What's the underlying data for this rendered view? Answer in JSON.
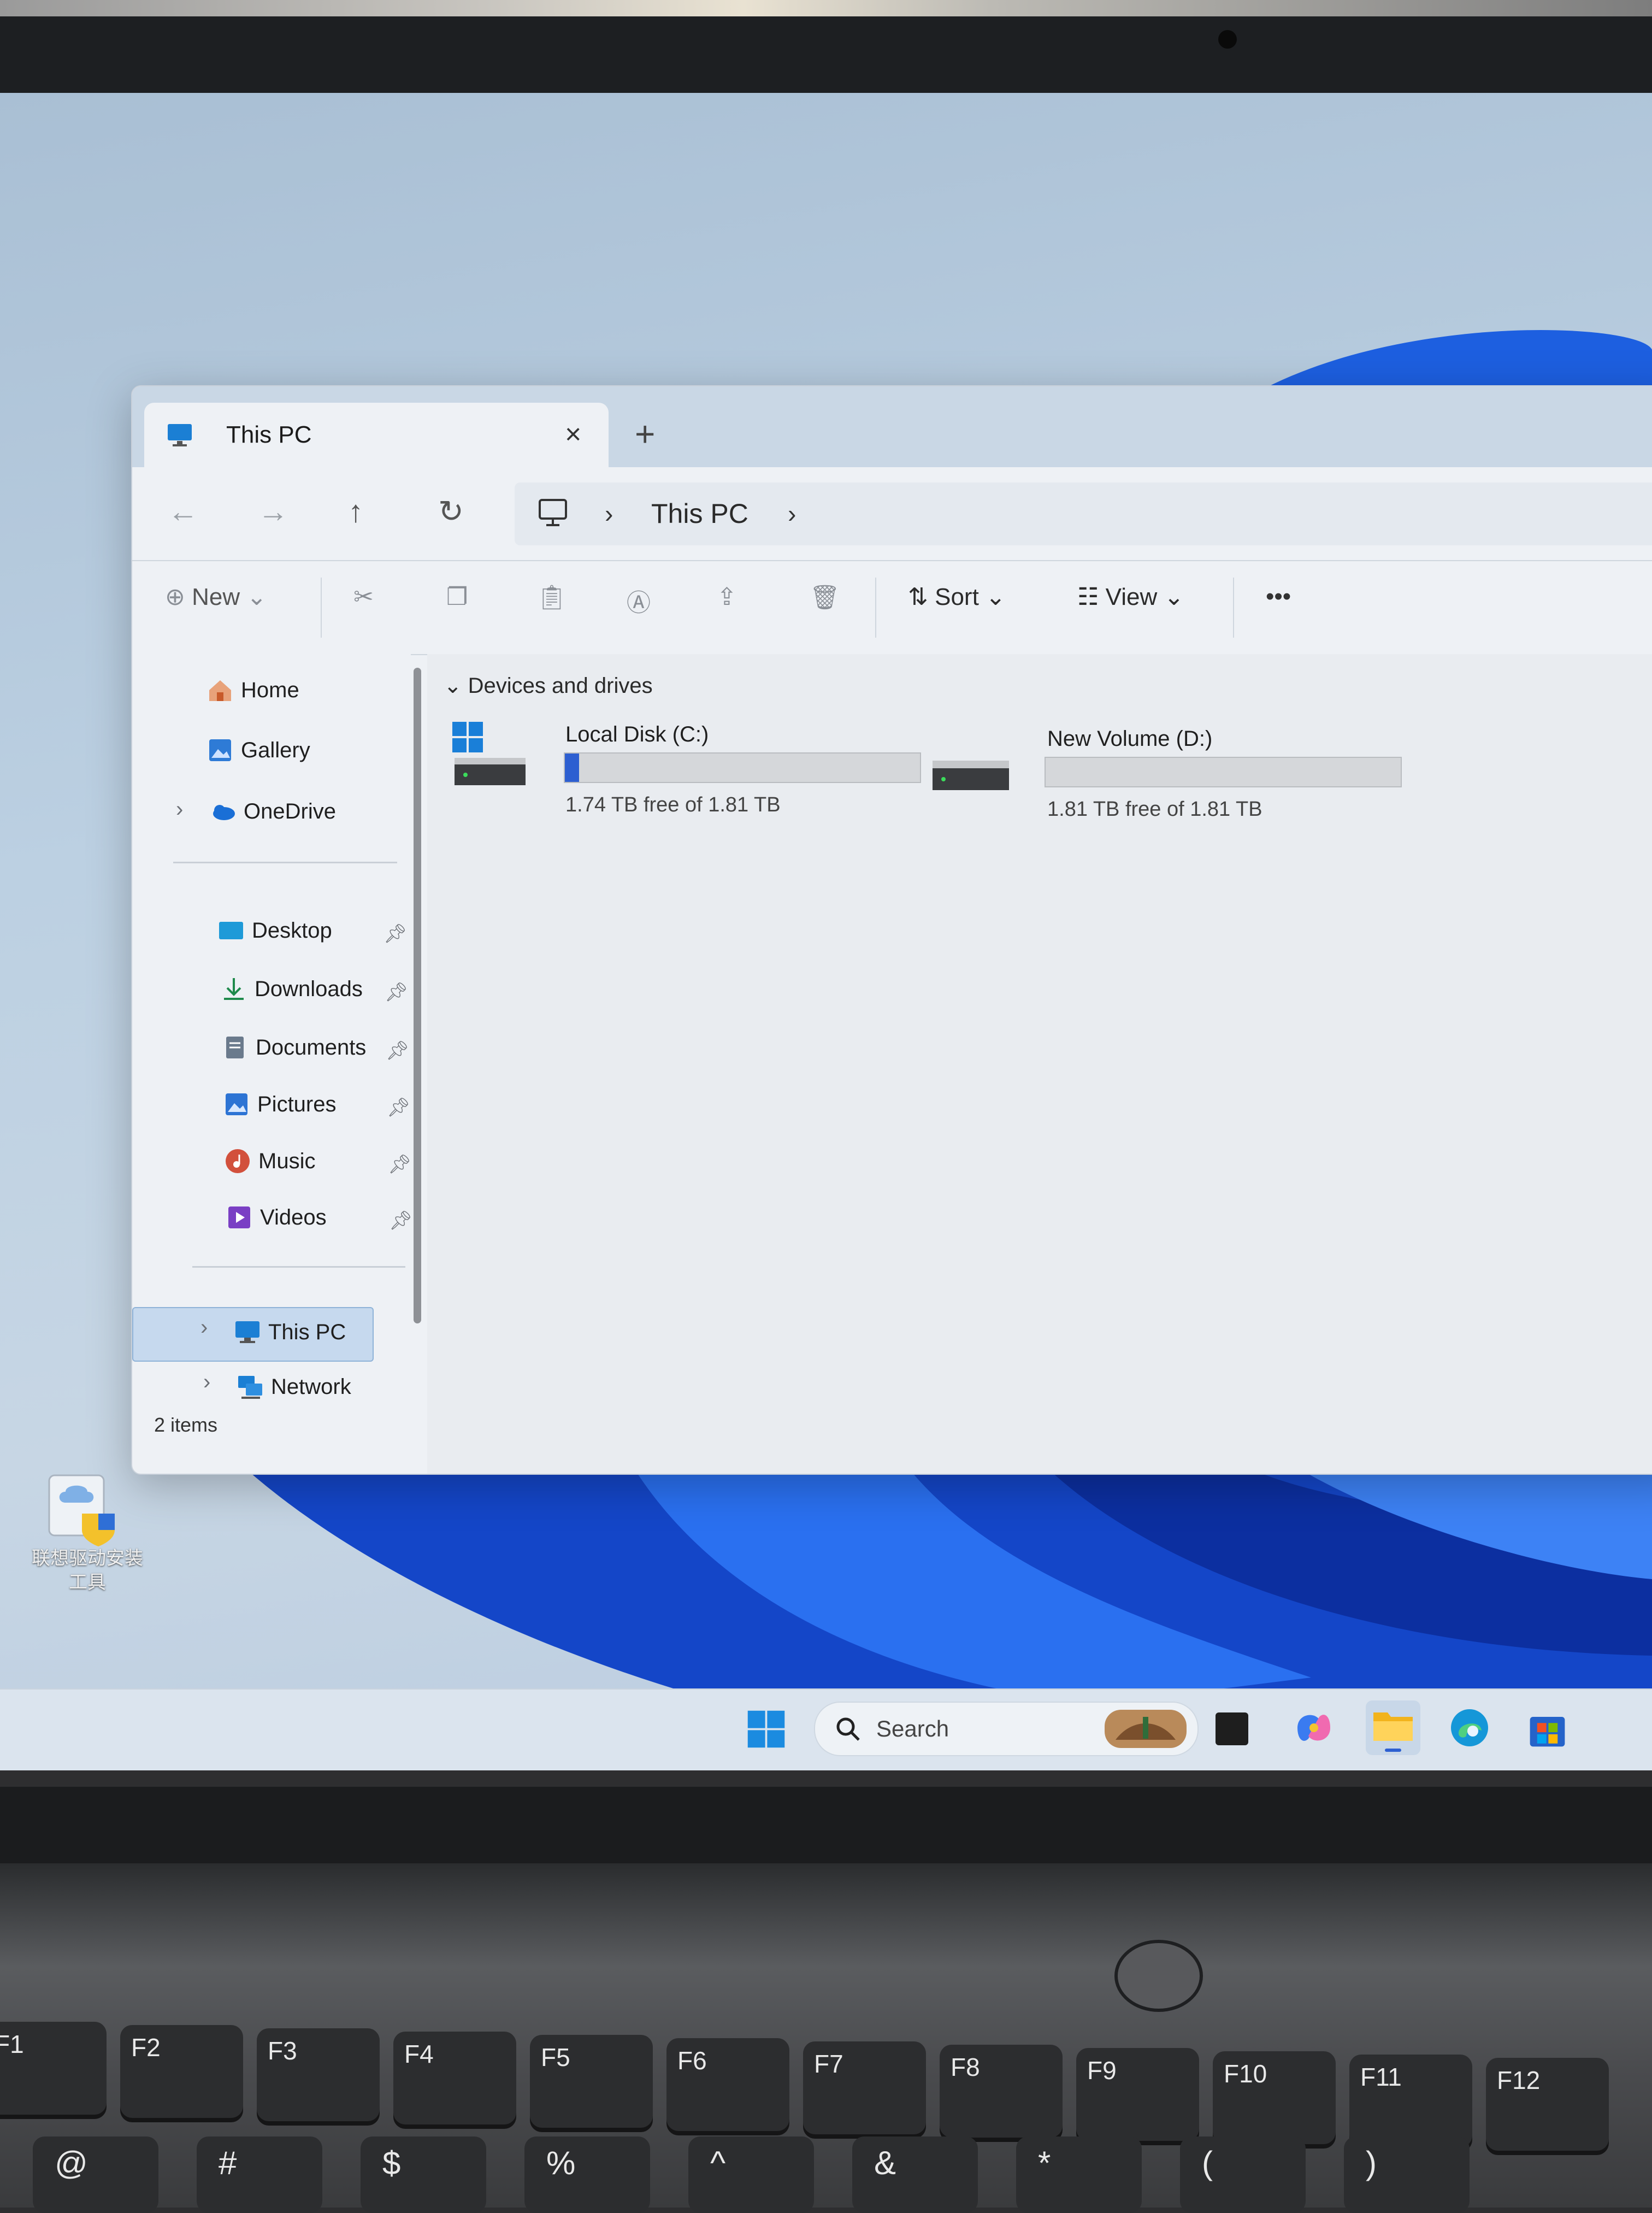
{
  "window": {
    "tab_title": "This PC",
    "tab_close": "×",
    "new_tab": "+",
    "address": {
      "separator": "›",
      "location": "This PC"
    }
  },
  "nav_icons": {
    "back": "←",
    "forward": "→",
    "up": "↑",
    "refresh": "↻"
  },
  "toolbar": {
    "new_label": "New",
    "sort_label": "Sort",
    "view_label": "View",
    "more_label": "•••",
    "chevron": "⌄"
  },
  "sidebar": {
    "items": [
      {
        "label": "Home"
      },
      {
        "label": "Gallery"
      },
      {
        "label": "OneDrive"
      },
      {
        "label": "Desktop"
      },
      {
        "label": "Downloads"
      },
      {
        "label": "Documents"
      },
      {
        "label": "Pictures"
      },
      {
        "label": "Music"
      },
      {
        "label": "Videos"
      },
      {
        "label": "This PC"
      },
      {
        "label": "Network"
      }
    ],
    "expander": "›"
  },
  "main": {
    "section_title": "Devices and drives",
    "section_chevron": "⌄",
    "drives": [
      {
        "name": "Local Disk (C:)",
        "free_text": "1.74 TB free of 1.81 TB",
        "used_fraction": 0.04
      },
      {
        "name": "New Volume (D:)",
        "free_text": "1.81 TB free of 1.81 TB",
        "used_fraction": 0.0
      }
    ]
  },
  "status_bar": {
    "items_count": "2 items"
  },
  "desktop": {
    "icon_label_line1": "联想驱动安装",
    "icon_label_line2": "工具"
  },
  "taskbar": {
    "search_placeholder": "Search"
  },
  "keyboard": {
    "fkeys": [
      "F1",
      "F2",
      "F3",
      "F4",
      "F5",
      "F6",
      "F7",
      "F8",
      "F9",
      "F10",
      "F11",
      "F12"
    ],
    "row2": [
      "@",
      "#",
      "$",
      "%",
      "^",
      "&",
      "*",
      "(",
      ")"
    ]
  },
  "colors": {
    "accent": "#2d5fd1",
    "selection": "#c6d9ee",
    "window_bg": "#eef1f5"
  }
}
